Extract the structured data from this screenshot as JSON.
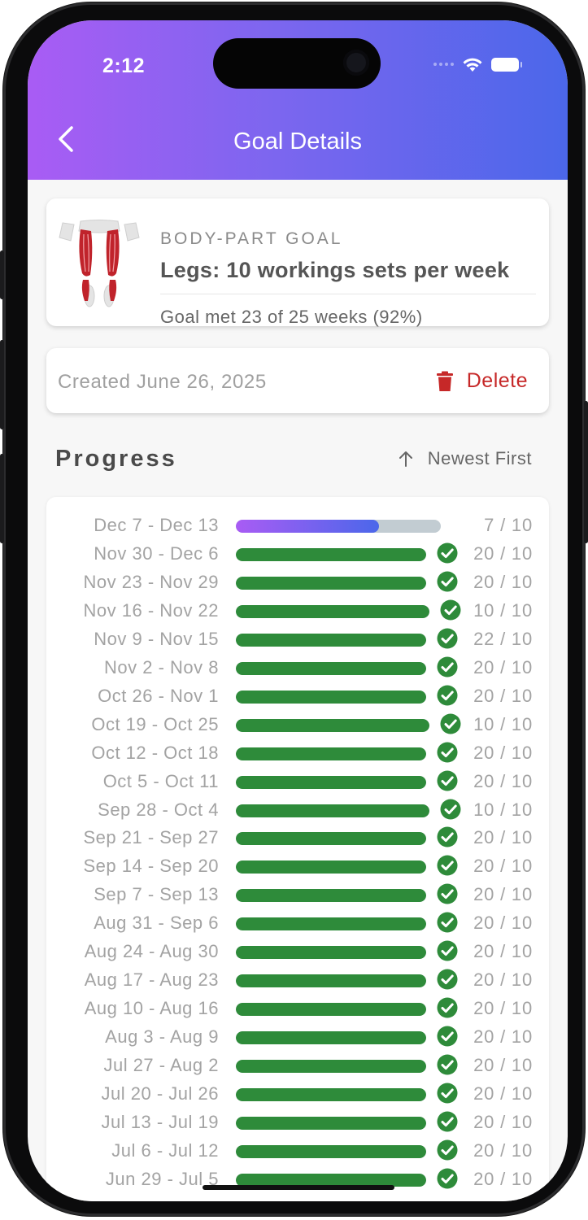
{
  "status_bar": {
    "time": "2:12"
  },
  "header": {
    "title": "Goal Details"
  },
  "goal_card": {
    "eyebrow": "BODY-PART GOAL",
    "title": "Legs: 10 workings sets per week",
    "summary": "Goal met 23 of 25 weeks (92%)"
  },
  "meta": {
    "created": "Created June 26, 2025",
    "delete_label": "Delete"
  },
  "progress": {
    "heading": "Progress",
    "sort_label": "Newest First",
    "weeks": [
      {
        "range": "Dec 7 - Dec 13",
        "count": "7 / 10",
        "done": 7,
        "goal": 10,
        "met": false,
        "current": true
      },
      {
        "range": "Nov 30 - Dec 6",
        "count": "20 / 10",
        "done": 20,
        "goal": 10,
        "met": true
      },
      {
        "range": "Nov 23 - Nov 29",
        "count": "20 / 10",
        "done": 20,
        "goal": 10,
        "met": true
      },
      {
        "range": "Nov 16 - Nov 22",
        "count": "10 / 10",
        "done": 10,
        "goal": 10,
        "met": true
      },
      {
        "range": "Nov 9 - Nov 15",
        "count": "22 / 10",
        "done": 22,
        "goal": 10,
        "met": true
      },
      {
        "range": "Nov 2 - Nov 8",
        "count": "20 / 10",
        "done": 20,
        "goal": 10,
        "met": true
      },
      {
        "range": "Oct 26 - Nov 1",
        "count": "20 / 10",
        "done": 20,
        "goal": 10,
        "met": true
      },
      {
        "range": "Oct 19 - Oct 25",
        "count": "10 / 10",
        "done": 10,
        "goal": 10,
        "met": true
      },
      {
        "range": "Oct 12 - Oct 18",
        "count": "20 / 10",
        "done": 20,
        "goal": 10,
        "met": true
      },
      {
        "range": "Oct 5 - Oct 11",
        "count": "20 / 10",
        "done": 20,
        "goal": 10,
        "met": true
      },
      {
        "range": "Sep 28 - Oct 4",
        "count": "10 / 10",
        "done": 10,
        "goal": 10,
        "met": true
      },
      {
        "range": "Sep 21 - Sep 27",
        "count": "20 / 10",
        "done": 20,
        "goal": 10,
        "met": true
      },
      {
        "range": "Sep 14 - Sep 20",
        "count": "20 / 10",
        "done": 20,
        "goal": 10,
        "met": true
      },
      {
        "range": "Sep 7 - Sep 13",
        "count": "20 / 10",
        "done": 20,
        "goal": 10,
        "met": true
      },
      {
        "range": "Aug 31 - Sep 6",
        "count": "20 / 10",
        "done": 20,
        "goal": 10,
        "met": true
      },
      {
        "range": "Aug 24 - Aug 30",
        "count": "20 / 10",
        "done": 20,
        "goal": 10,
        "met": true
      },
      {
        "range": "Aug 17 - Aug 23",
        "count": "20 / 10",
        "done": 20,
        "goal": 10,
        "met": true
      },
      {
        "range": "Aug 10 - Aug 16",
        "count": "20 / 10",
        "done": 20,
        "goal": 10,
        "met": true
      },
      {
        "range": "Aug 3 - Aug 9",
        "count": "20 / 10",
        "done": 20,
        "goal": 10,
        "met": true
      },
      {
        "range": "Jul 27 - Aug 2",
        "count": "20 / 10",
        "done": 20,
        "goal": 10,
        "met": true
      },
      {
        "range": "Jul 20 - Jul 26",
        "count": "20 / 10",
        "done": 20,
        "goal": 10,
        "met": true
      },
      {
        "range": "Jul 13 - Jul 19",
        "count": "20 / 10",
        "done": 20,
        "goal": 10,
        "met": true
      },
      {
        "range": "Jul 6 - Jul 12",
        "count": "20 / 10",
        "done": 20,
        "goal": 10,
        "met": true
      },
      {
        "range": "Jun 29 - Jul 5",
        "count": "20 / 10",
        "done": 20,
        "goal": 10,
        "met": true
      }
    ]
  },
  "colors": {
    "header_gradient": [
      "#a95cf4",
      "#4b67ea"
    ],
    "met_bar": "#2e8b3a",
    "check": "#2e8b3a",
    "track": "#c2ccd2",
    "delete": "#c62828"
  }
}
